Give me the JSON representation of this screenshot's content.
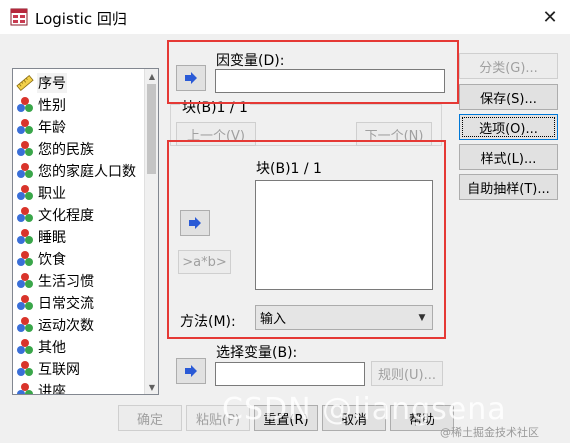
{
  "window": {
    "title": "Logistic 回归",
    "close_glyph": "✕"
  },
  "variable_list": {
    "items": [
      {
        "label": "序号",
        "icon": "ruler-icon"
      },
      {
        "label": "性别",
        "icon": "nominal-icon"
      },
      {
        "label": "年龄",
        "icon": "nominal-icon"
      },
      {
        "label": "您的民族",
        "icon": "nominal-icon"
      },
      {
        "label": "您的家庭人口数",
        "icon": "nominal-icon"
      },
      {
        "label": "职业",
        "icon": "nominal-icon"
      },
      {
        "label": "文化程度",
        "icon": "nominal-icon"
      },
      {
        "label": "睡眠",
        "icon": "nominal-icon"
      },
      {
        "label": "饮食",
        "icon": "nominal-icon"
      },
      {
        "label": "生活习惯",
        "icon": "nominal-icon"
      },
      {
        "label": "日常交流",
        "icon": "nominal-icon"
      },
      {
        "label": "运动次数",
        "icon": "nominal-icon"
      },
      {
        "label": "其他",
        "icon": "nominal-icon"
      },
      {
        "label": "互联网",
        "icon": "nominal-icon"
      },
      {
        "label": "讲座",
        "icon": "nominal-icon"
      }
    ]
  },
  "dependent": {
    "label": "因变量(D):",
    "value": ""
  },
  "block_outer": {
    "label": "块(B)1 / 1",
    "prev": "上一个(V)",
    "next": "下一个(N)"
  },
  "block_inner": {
    "label": "块(B)1 / 1",
    "interaction_button": ">a*b>"
  },
  "method": {
    "label": "方法(M):",
    "value": "输入"
  },
  "selection": {
    "label": "选择变量(B):",
    "value": "",
    "rule_button": "规则(U)..."
  },
  "side_buttons": {
    "categorical": "分类(G)...",
    "save": "保存(S)...",
    "options": "选项(O)...",
    "style": "样式(L)...",
    "bootstrap": "自助抽样(T)..."
  },
  "bottom_buttons": {
    "ok": "确定",
    "paste": "粘贴(P)",
    "reset": "重置(R)",
    "cancel": "取消",
    "help": "帮助"
  },
  "watermark": {
    "main": "CSDN @liangsena",
    "corner": "@稀土掘金技术社区"
  },
  "colors": {
    "accent_red": "#e53935",
    "arrow_blue": "#2a5ad6",
    "focus_blue": "#0078d7"
  }
}
